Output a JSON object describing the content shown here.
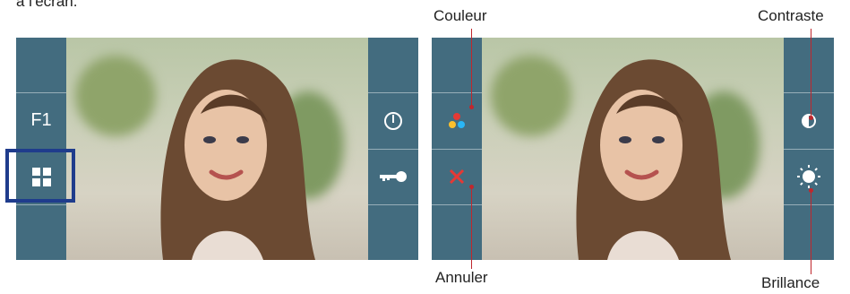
{
  "header": {
    "fragment_text": "à l'écran."
  },
  "left_monitor": {
    "left_buttons": [
      "",
      "F1",
      "",
      ""
    ],
    "right_buttons": [
      "",
      "",
      "",
      ""
    ]
  },
  "right_monitor": {
    "callouts": {
      "couleur": "Couleur",
      "contraste": "Contraste",
      "annuler": "Annuler",
      "brillance": "Brillance"
    }
  },
  "colors": {
    "panel": "#436c7f",
    "highlight": "#1f3c8c",
    "callout_line": "#c0272d",
    "cancel_x": "#e53935"
  },
  "icons": {
    "menu": "grid-icon",
    "power": "power-icon",
    "key": "key-icon",
    "color": "color-dots-icon",
    "cancel": "close-icon",
    "contrast": "contrast-icon",
    "brightness": "sun-icon"
  }
}
